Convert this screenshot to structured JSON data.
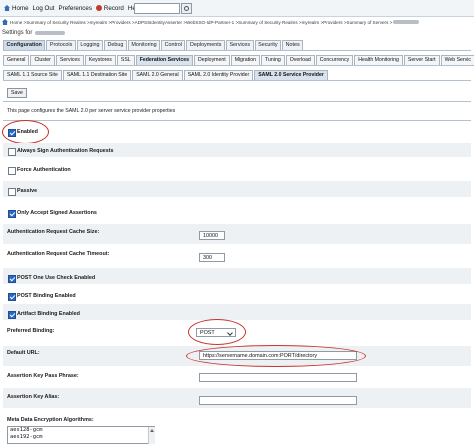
{
  "topbar": {
    "home": "Home",
    "logout": "Log Out",
    "preferences": "Preferences",
    "record": "Record",
    "help": "Help"
  },
  "breadcrumb": {
    "text_a": "Home >Summary of Security Realms >myrealm >Providers >ADPSSIdentityAsserter >WebSSO-IdP-Partner-1 >Summary of Security Realms >myrealm >Providers >Summary of Servers >"
  },
  "settings_for": "Settings for",
  "tabs_main": [
    "Configuration",
    "Protocols",
    "Logging",
    "Debug",
    "Monitoring",
    "Control",
    "Deployments",
    "Services",
    "Security",
    "Notes"
  ],
  "tabs_config": [
    "General",
    "Cluster",
    "Services",
    "Keystores",
    "SSL",
    "Federation Services",
    "Deployment",
    "Migration",
    "Tuning",
    "Overload",
    "Concurrency",
    "Health Monitoring",
    "Server Start",
    "Web Servic"
  ],
  "tabs_saml": [
    "SAML 1.1 Source Site",
    "SAML 1.1 Destination Site",
    "SAML 2.0 General",
    "SAML 2.0 Identity Provider",
    "SAML 2.0 Service Provider"
  ],
  "save_label": "Save",
  "description": "This page configures the SAML 2.0 per server service provider properties",
  "checkboxes": {
    "enabled": {
      "label": "Enabled",
      "checked": true
    },
    "always_sign": {
      "label": "Always Sign Authentication Requests",
      "checked": false
    },
    "force_auth": {
      "label": "Force Authentication",
      "checked": false
    },
    "passive": {
      "label": "Passive",
      "checked": false
    },
    "only_signed": {
      "label": "Only Accept Signed Assertions",
      "checked": true
    },
    "post_one_use": {
      "label": "POST One Use Check Enabled",
      "checked": true
    },
    "post_binding": {
      "label": "POST Binding Enabled",
      "checked": true
    },
    "artifact_binding": {
      "label": "Artifact Binding Enabled",
      "checked": true
    }
  },
  "fields": {
    "cache_size": {
      "label": "Authentication Request Cache Size:",
      "value": "10000"
    },
    "cache_timeout": {
      "label": "Authentication Request Cache Timeout:",
      "value": "300"
    },
    "preferred_binding": {
      "label": "Preferred Binding:",
      "value": "POST"
    },
    "default_url": {
      "label": "Default URL:",
      "value": "https://servername.domain.com:PORT/directory"
    },
    "key_pass": {
      "label": "Assertion Key Pass Phrase:",
      "value": ""
    },
    "key_alias": {
      "label": "Assertion Key Alias:",
      "value": ""
    },
    "enc_algs": {
      "label": "Meta Data Encryption Algorithms:",
      "options": [
        "aes128-gcm",
        "aes192-gcm"
      ]
    }
  },
  "colors": {
    "annotation": "#c8332b",
    "accent": "#2a68c4"
  }
}
